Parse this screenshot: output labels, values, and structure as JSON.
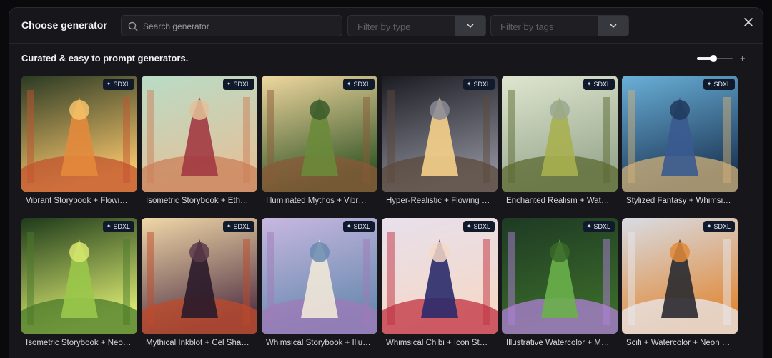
{
  "modal": {
    "title": "Choose generator",
    "search": {
      "placeholder": "Search generator",
      "value": ""
    },
    "filters": [
      {
        "label": "Filter by type"
      },
      {
        "label": "Filter by tags"
      }
    ],
    "close_icon": "close-icon",
    "subtitle": "Curated & easy to prompt generators.",
    "zoom": {
      "minus": "–",
      "plus": "+",
      "level": 0.45
    }
  },
  "generators": [
    {
      "label": "Vibrant Storybook + Flowi…",
      "badge": "SDXL",
      "palette": [
        "#2a3a24",
        "#e38a3c",
        "#c2532e",
        "#f4c36a"
      ]
    },
    {
      "label": "Isometric Storybook + Eth…",
      "badge": "SDXL",
      "palette": [
        "#b9dcc6",
        "#a23a43",
        "#c9805a",
        "#e2c19a"
      ]
    },
    {
      "label": "Illuminated Mythos + Vibr…",
      "badge": "SDXL",
      "palette": [
        "#f0d7a0",
        "#6a8a3a",
        "#8a5a38",
        "#3a5a2a"
      ]
    },
    {
      "label": "Hyper-Realistic + Flowing …",
      "badge": "SDXL",
      "palette": [
        "#1b1b22",
        "#f5d08a",
        "#5b4a3c",
        "#8a8a96"
      ]
    },
    {
      "label": "Enchanted Realism + Wat…",
      "badge": "SDXL",
      "palette": [
        "#dfe6cf",
        "#a8b050",
        "#5c6a30",
        "#9aa890"
      ]
    },
    {
      "label": "Stylized Fantasy + Whimsi…",
      "badge": "SDXL",
      "palette": [
        "#6ab0d8",
        "#3a5a90",
        "#d0b078",
        "#1e3a5a"
      ]
    },
    {
      "label": "Isometric Storybook + Neo…",
      "badge": "SDXL",
      "palette": [
        "#1e3a1a",
        "#9ac84a",
        "#4a7a2a",
        "#d8e870"
      ]
    },
    {
      "label": "Mythical Inkblot + Cel Sha…",
      "badge": "SDXL",
      "palette": [
        "#f0d8a8",
        "#2a1a2a",
        "#c04a2a",
        "#5a3a4a"
      ]
    },
    {
      "label": "Whimsical Storybook + Illu…",
      "badge": "SDXL",
      "palette": [
        "#c8b8e0",
        "#f0e8d8",
        "#a07ab8",
        "#6a8ab0"
      ]
    },
    {
      "label": "Whimsical Chibi + Icon St…",
      "badge": "SDXL",
      "palette": [
        "#e8e0ec",
        "#2a2a6a",
        "#c03040",
        "#f4d8c8"
      ]
    },
    {
      "label": "Illustrative Watercolor + M…",
      "badge": "SDXL",
      "palette": [
        "#1e3a24",
        "#6ab04a",
        "#b080d8",
        "#3a6a2a"
      ]
    },
    {
      "label": "Scifi + Watercolor + Neon …",
      "badge": "SDXL",
      "palette": [
        "#d8dce4",
        "#2a2a30",
        "#e8e8ee",
        "#e08a3a"
      ]
    }
  ]
}
